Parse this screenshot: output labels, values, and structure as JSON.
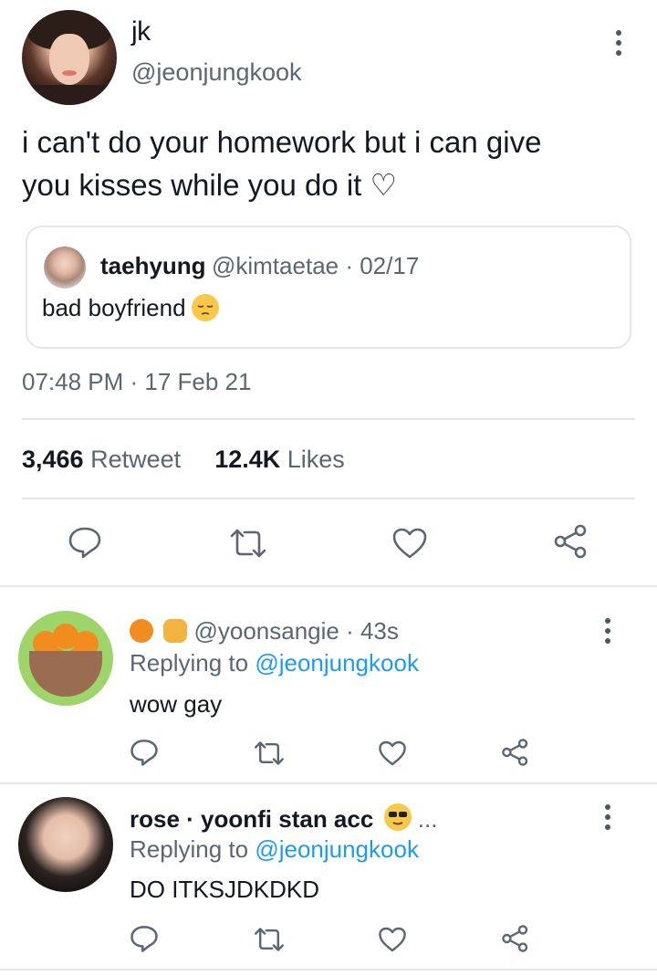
{
  "main_tweet": {
    "name": "jk",
    "handle": "@jeonjungkook",
    "text_line1": "i can't do your homework but i can give",
    "text_line2": "you kisses while you do it ♡",
    "timestamp": "07:48 PM · 17 Feb 21",
    "retweet_count": "3,466",
    "retweet_label": "Retweet",
    "like_count": "12.4K",
    "like_label": "Likes"
  },
  "quote": {
    "name": "taehyung",
    "handle_date": "@kimtaetae · 02/17",
    "text": "bad boyfriend"
  },
  "replies": [
    {
      "handle_time": "@yoonsangie · 43s",
      "replying_prefix": "Replying to",
      "replying_to": "@jeonjungkook",
      "text": "wow gay"
    },
    {
      "name": "rose · yoonfi stan acc",
      "ellipsis": "...",
      "replying_prefix": "Replying to",
      "replying_to": "@jeonjungkook",
      "text": "DO ITKSJDKDKD"
    }
  ],
  "icons": {
    "reply": "reply-icon",
    "retweet": "retweet-icon",
    "like": "heart-icon",
    "share": "share-icon",
    "more": "more-vertical-icon"
  },
  "colors": {
    "text_primary": "#141823",
    "text_secondary": "#5b6770",
    "mention": "#1d9bf0",
    "divider": "#e3e7ea"
  }
}
